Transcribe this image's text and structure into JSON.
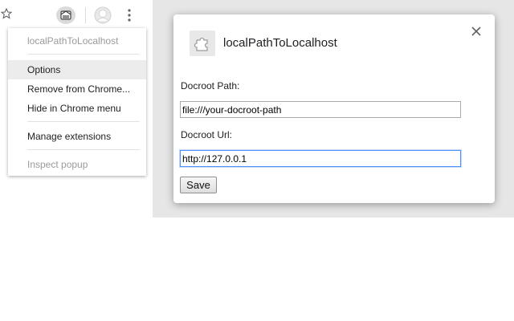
{
  "extension_menu": {
    "title": "localPathToLocalhost",
    "items": [
      {
        "label": "Options"
      },
      {
        "label": "Remove from Chrome..."
      },
      {
        "label": "Hide in Chrome menu"
      },
      {
        "label": "Manage extensions"
      },
      {
        "label": "Inspect popup"
      }
    ]
  },
  "toolbar": {
    "icons": [
      "bookmark-star-icon",
      "extension-icon",
      "profile-icon",
      "chrome-menu-icon"
    ]
  },
  "options_dialog": {
    "title": "localPathToLocalhost",
    "fields": [
      {
        "label": "Docroot Path:",
        "value": "file:///your-docroot-path"
      },
      {
        "label": "Docroot Url:",
        "value": "http://127.0.0.1"
      }
    ],
    "save_label": "Save"
  },
  "colors": {
    "focus_border": "#4d90fe",
    "backdrop": "#e6e6e6",
    "menu_hover": "#ececec",
    "disabled_text": "#9a9a9a"
  }
}
